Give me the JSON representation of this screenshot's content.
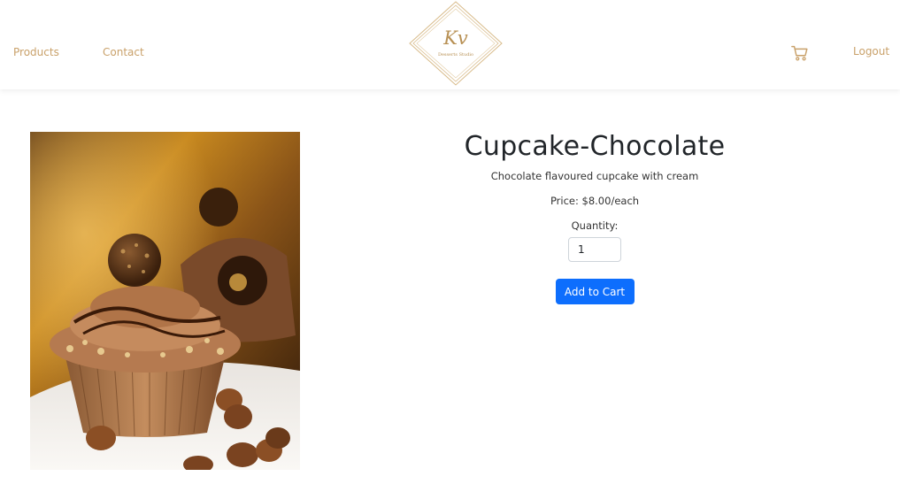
{
  "nav": {
    "products_label": "Products",
    "contact_label": "Contact",
    "logout_label": "Logout",
    "cart_icon": "cart-icon"
  },
  "logo": {
    "monogram": "Kv",
    "tagline": "Desserts Studio"
  },
  "product": {
    "title": "Cupcake-Chocolate",
    "description": "Chocolate flavoured cupcake with cream",
    "price": "Price: $8.00/each",
    "quantity_label": "Quantity:",
    "quantity_value": "1",
    "add_to_cart_label": "Add to Cart",
    "image_subject": "chocolate cupcake with hazelnut praline"
  },
  "colors": {
    "accent_gold": "#c9a16a",
    "button_blue": "#0d6efd"
  }
}
